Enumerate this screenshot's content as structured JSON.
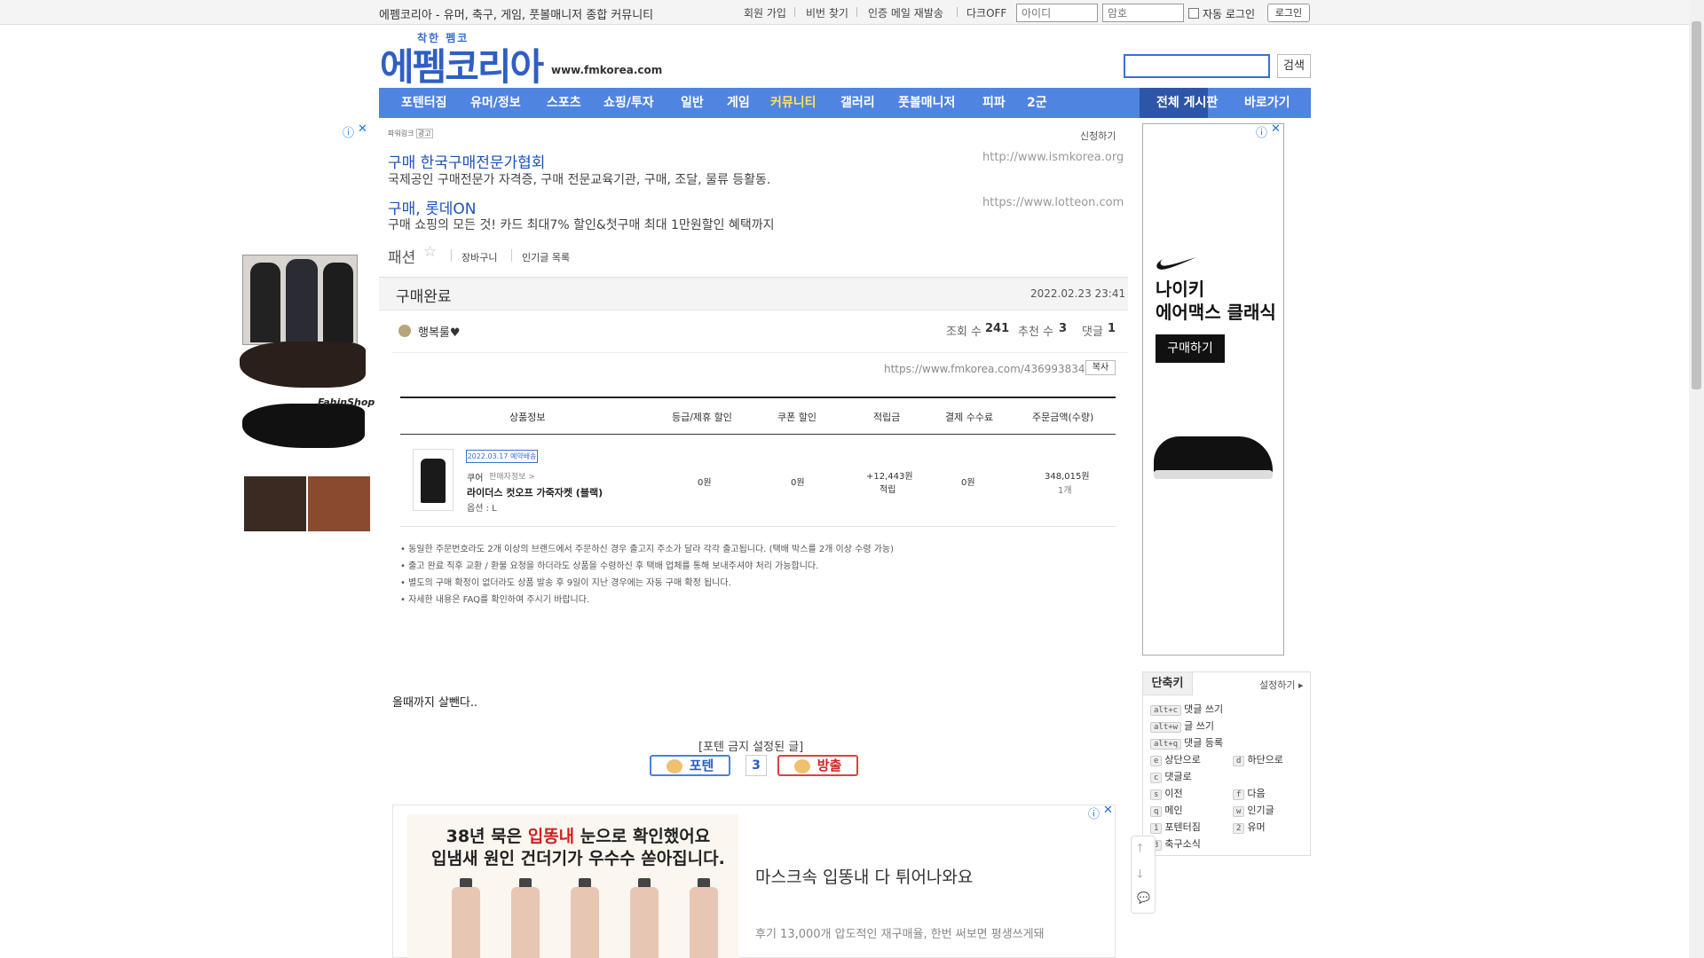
{
  "topbar": {
    "site_desc": "에펨코리아 - 유머, 축구, 게임, 풋볼매니저 종합 커뮤니티",
    "links": [
      "회원 가입",
      "비번 찾기",
      "인증 메일 재발송",
      "다크OFF"
    ],
    "id_placeholder": "아이디",
    "pw_placeholder": "암호",
    "auto_login": "자동 로그인",
    "login": "로그인"
  },
  "header": {
    "logo_small": "착한 펨코",
    "logo_main": "에펨코리아",
    "url": "www.fmkorea.com",
    "search_button": "검색"
  },
  "nav": {
    "items": [
      "포텐터짐",
      "유머/정보",
      "스포츠",
      "쇼핑/투자",
      "일반",
      "게임",
      "커뮤니티",
      "갤러리",
      "풋볼매니저",
      "피파",
      "2군"
    ],
    "active": "커뮤니티",
    "right": [
      "전체 게시판",
      "바로가기"
    ]
  },
  "left_ad": {
    "brand": "FahinShop"
  },
  "powerlink": {
    "title": "파워링크",
    "badge": "광고",
    "request": "신청하기",
    "ads": [
      {
        "title": "구매 한국구매전문가협회",
        "desc": "국제공인 구매전문가 자격증, 구매 전문교육기관, 구매, 조달, 물류 등활동.",
        "url": "http://www.ismkorea.org"
      },
      {
        "title": "구매, 롯데ON",
        "desc": "구매 쇼핑의 모든 것! 카드 최대7% 할인&첫구매 최대 1만원할인 혜택까지",
        "url": "https://www.lotteon.com"
      }
    ]
  },
  "board": {
    "name": "패션",
    "star": "☆",
    "cart": "장바구니",
    "popular": "인기글 목록"
  },
  "post": {
    "title": "구매완료",
    "date": "2022.02.23 23:41",
    "author": "행복룰♥",
    "views_label": "조회 수",
    "views": "241",
    "likes_label": "추천 수",
    "likes": "3",
    "comments_label": "댓글",
    "comments": "1",
    "url": "https://www.fmkorea.com/4369938348",
    "copy": "복사",
    "body": "올때까지 살뺀다.."
  },
  "order": {
    "headers": [
      "상품정보",
      "등급/제휴 할인",
      "쿠폰 할인",
      "적립금",
      "결제 수수료",
      "주문금액(수량)"
    ],
    "ship_badge": "2022.03.17 예약배송",
    "seller": "쿠어",
    "seller_info": "판매자정보 >",
    "product": "라이더스 컷오프 가죽자켓 (블랙)",
    "option": "옵션 : L",
    "grade_discount": "0원",
    "coupon_discount": "0원",
    "points": "+12,443원",
    "points_label": "적립",
    "fee": "0원",
    "amount": "348,015원",
    "qty": "1개",
    "notes": [
      "• 동일한 주문번호라도 2개 이상의 브랜드에서 주문하신 경우 출고지 주소가 달라 각각 출고됩니다. (택배 박스를 2개 이상 수령 가능)",
      "• 출고 완료 직후 교환 / 환불 요청을 하더라도 상품을 수령하신 후 택배 업체를 통해 보내주셔야 처리 가능합니다.",
      "• 별도의 구매 확정이 없더라도 상품 발송 후 9일이 지난 경우에는 자동 구매 확정 됩니다.",
      "• 자세한 내용은 FAQ를 확인하여 주시기 바랍니다."
    ]
  },
  "potn": {
    "label": "[포텐 금지 설정된 글]",
    "up": "포텐",
    "count": "3",
    "down": "방출"
  },
  "bottom_ad": {
    "headline1_pre": "38년 묵은 ",
    "headline1_red": "입똥내",
    "headline1_post": " 눈으로 확인했어요",
    "headline2": "입냄새 원인 건더기가 우수수 쏟아집니다.",
    "title": "마스크속 입똥내 다 튀어나와요",
    "desc": "후기 13,000개 압도적인 재구매율, 한번 써보면 평생쓰게돼"
  },
  "right_ad": {
    "title1": "나이키",
    "title2": "에어맥스 클래식",
    "button": "구매하기"
  },
  "shortcuts": {
    "tab": "단축키",
    "setting": "설정하기",
    "items": [
      {
        "key": "alt+c",
        "label": "댓글 쓰기"
      },
      {
        "key": "alt+w",
        "label": "글 쓰기"
      },
      {
        "key": "alt+q",
        "label": "댓글 등록"
      },
      {
        "key": "e",
        "label": "상단으로"
      },
      {
        "key": "d",
        "label": "하단으로"
      },
      {
        "key": "c",
        "label": "댓글로"
      },
      {
        "key": "s",
        "label": "이전"
      },
      {
        "key": "f",
        "label": "다음"
      },
      {
        "key": "q",
        "label": "메인"
      },
      {
        "key": "w",
        "label": "인기글"
      },
      {
        "key": "1",
        "label": "포텐터짐"
      },
      {
        "key": "2",
        "label": "유머"
      },
      {
        "key": "3",
        "label": "축구소식"
      }
    ]
  },
  "colors": {
    "nav": "#4f84e0",
    "nav_active": "#2d55a8",
    "link": "#1a52b8",
    "potn": "#2a5cc4",
    "ban": "#d02020"
  }
}
